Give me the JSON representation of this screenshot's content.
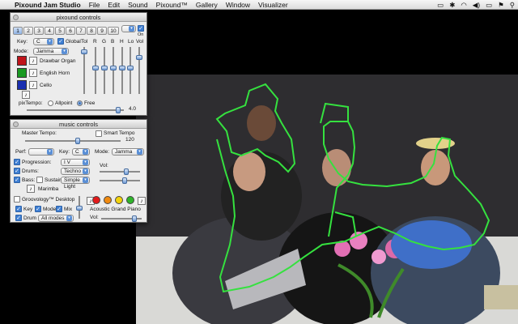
{
  "menubar": {
    "app": "Pixound Jam Studio",
    "items": [
      "File",
      "Edit",
      "Sound",
      "Pixound™",
      "Gallery",
      "Window",
      "Visualizer"
    ]
  },
  "pixound_controls": {
    "title": "pixound controls",
    "tabs": [
      "1",
      "2",
      "3",
      "4",
      "5",
      "6",
      "7",
      "8",
      "9",
      "10"
    ],
    "on_label": "On",
    "key_label": "Key:",
    "key_value": "C",
    "global_label": "Global",
    "mode_label": "Mode:",
    "mode_value": "Jamma",
    "column_headers": [
      "Tol",
      "R",
      "G",
      "B",
      "H",
      "Lo",
      "Vol"
    ],
    "instruments": [
      {
        "name": "Drawbar Organ",
        "color": "#c0141a"
      },
      {
        "name": "English Horn",
        "color": "#1a9a23"
      },
      {
        "name": "Cello",
        "color": "#1a2fb0"
      }
    ],
    "pixtempo_label": "pixTempo:",
    "allpoint_label": "Allpoint",
    "free_label": "Free",
    "tempo_value": "4.0",
    "slider_levels": [
      0.05,
      0.45,
      0.45,
      0.45,
      0.45,
      0.45,
      0.2
    ]
  },
  "music_controls": {
    "title": "music controls",
    "master_tempo_label": "Master Tempo:",
    "master_tempo_value": "120",
    "master_tempo_level": 0.55,
    "smart_tempo_label": "Smart Tempo",
    "perf_label": "Perf:",
    "key_label": "Key:",
    "key_value": "C",
    "mode_label": "Mode:",
    "mode_value": "Jamma",
    "progression_label": "Progression:",
    "progression_value": "I V",
    "drums_label": "Drums:",
    "drums_value": "Techno",
    "bass_label": "Bass:",
    "sustain_label": "Sustain",
    "bass_value": "Simple Light",
    "vol_label": "Vol:",
    "marimba_label": "Marimba",
    "groovology_label": "Groovology™ Desktop",
    "key_chk": "Key",
    "mode_chk": "Mode",
    "mix_chk": "Mix",
    "drum_chk": "Drum",
    "all_modes": "All modes",
    "instrument_value": "Acoustic Grand Piano",
    "vol2_label": "Vol:",
    "groove_colors": [
      "#e21a1a",
      "#f08a10",
      "#f2d20c",
      "#2fb52b"
    ]
  },
  "colors": {
    "outline_stroke": "#35e13f",
    "accent": "#3f7fd3"
  }
}
